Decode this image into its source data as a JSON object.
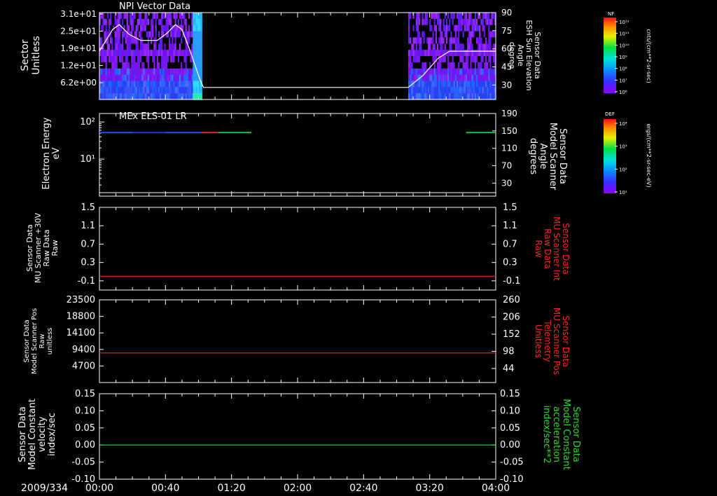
{
  "timeline": {
    "date": "2009/334",
    "ticks": [
      {
        "t": 0,
        "label": "00:00"
      },
      {
        "t": 40,
        "label": "00:40"
      },
      {
        "t": 80,
        "label": "01:20"
      },
      {
        "t": 120,
        "label": "02:00"
      },
      {
        "t": 160,
        "label": "02:40"
      },
      {
        "t": 200,
        "label": "03:20"
      },
      {
        "t": 240,
        "label": "04:00"
      }
    ]
  },
  "colors": {
    "background": "#000000",
    "axis": "#ffffff",
    "red_trace": "#ff2020",
    "green_trace": "#22dd22",
    "red_label": "#ff2020",
    "green_label": "#22dd22"
  },
  "chart_data": [
    {
      "type": "heatmap",
      "title": "NPI Vector Data",
      "ylabel": [
        "Sector",
        "Unitless"
      ],
      "yticks": [
        "3.1e+01",
        "2.5e+01",
        "1.9e+01",
        "1.2e+01",
        "6.2e+00"
      ],
      "y2label": [
        "Sensor Data",
        "ESH Sun Elevation",
        "Angle",
        "degree"
      ],
      "y2ticks": [
        90,
        75,
        60,
        45,
        30
      ],
      "colorbar": {
        "label": "NF",
        "unit": "cnts/(cm**2-sr-sec)",
        "ticks": [
          "10¹²",
          "10¹¹",
          "10¹⁰",
          "10⁹",
          "10⁸",
          "10⁷",
          "10⁶"
        ]
      },
      "coverage_minutes": [
        [
          0,
          62
        ],
        [
          187,
          240
        ]
      ],
      "overlay_line": {
        "name": "ESH Sun Elevation Angle",
        "y2lim": [
          18,
          90
        ],
        "points": [
          [
            0,
            58
          ],
          [
            8,
            76
          ],
          [
            12,
            80
          ],
          [
            18,
            72
          ],
          [
            25,
            67
          ],
          [
            35,
            67
          ],
          [
            41,
            73
          ],
          [
            46,
            80
          ],
          [
            50,
            76
          ],
          [
            55,
            58
          ],
          [
            61,
            34
          ],
          [
            63,
            28
          ],
          [
            187,
            28
          ],
          [
            196,
            38
          ],
          [
            205,
            52
          ],
          [
            212,
            58
          ],
          [
            240,
            58
          ]
        ]
      }
    },
    {
      "type": "line",
      "title": "MEx ELS-01 LR",
      "ylabel": [
        "Electron Energy",
        "eV"
      ],
      "ylog": true,
      "ylim": [
        1,
        170
      ],
      "yticks": [
        {
          "value": 100,
          "label": "10²"
        },
        {
          "value": 10,
          "label": "10¹"
        }
      ],
      "y2label": [
        "Sensor Data",
        "Model Scanner",
        "Angle",
        "degrees"
      ],
      "y2lim": [
        0,
        190
      ],
      "y2ticks": [
        190,
        150,
        110,
        70,
        30
      ],
      "colorbar": {
        "label": "DEF",
        "unit": "ergs/(cm**2-sr-sec-eV)",
        "ticks": [
          "10⁴",
          "10³",
          "10²",
          "10¹"
        ]
      },
      "energy_band": {
        "value": 52,
        "segments": [
          [
            0,
            20,
            "#1c56e8"
          ],
          [
            20,
            40,
            "#0c3fcf"
          ],
          [
            40,
            62,
            "#1c56e8"
          ],
          [
            62,
            72,
            "#d83020"
          ],
          [
            72,
            92,
            "#22bb55"
          ],
          [
            222,
            240,
            "#22bb55"
          ]
        ]
      },
      "scanner_angle": {
        "points": [
          [
            0,
            8
          ],
          [
            240,
            8
          ]
        ]
      }
    },
    {
      "type": "line",
      "ylabel": [
        "Sensor Data",
        "MU Scanner +30V",
        "Raw Data",
        "Raw"
      ],
      "ylim": [
        -0.3,
        1.5
      ],
      "yticks": [
        1.5,
        1.1,
        0.7,
        0.3,
        -0.1
      ],
      "y2label": [
        "Sensor Data",
        "MU Scanner Int",
        "Raw Data",
        "Raw"
      ],
      "series": [
        {
          "color": "#ff2020",
          "axis": "y2",
          "points": [
            [
              0,
              0
            ],
            [
              240,
              0
            ]
          ]
        }
      ]
    },
    {
      "type": "line",
      "ylabel": [
        "Sensor Data",
        "Model Scanner Pos",
        "Raw",
        "unitless"
      ],
      "ylim": [
        0,
        23500
      ],
      "yticks": [
        23500,
        18800,
        14100,
        9400,
        4700
      ],
      "y2label": [
        "Sensor Data",
        "MU Scanner Pos",
        "Telemetry",
        "Unitless"
      ],
      "y2lim": [
        0,
        260
      ],
      "y2ticks": [
        260,
        206,
        152,
        98,
        44
      ],
      "series": [
        {
          "color": "#ff2020",
          "axis": "y",
          "points": [
            [
              0,
              8400
            ],
            [
              240,
              8400
            ]
          ]
        }
      ]
    },
    {
      "type": "line",
      "ylabel": [
        "Sensor Data",
        "Model Constant",
        "velocity",
        "index/sec"
      ],
      "ylim": [
        -0.1,
        0.15
      ],
      "yticks": [
        "0.15",
        "0.10",
        "0.05",
        "0.00",
        "-0.05",
        "-0.10"
      ],
      "y2label": [
        "Sensor Data",
        "Model Constant",
        "acceleration",
        "index/sec**2"
      ],
      "y2ticks": [
        "0.15",
        "0.10",
        "0.05",
        "0.00",
        "-0.05",
        "-0.10"
      ],
      "series": [
        {
          "color": "#22dd22",
          "axis": "y",
          "points": [
            [
              0,
              0
            ],
            [
              240,
              0
            ]
          ]
        }
      ]
    }
  ]
}
